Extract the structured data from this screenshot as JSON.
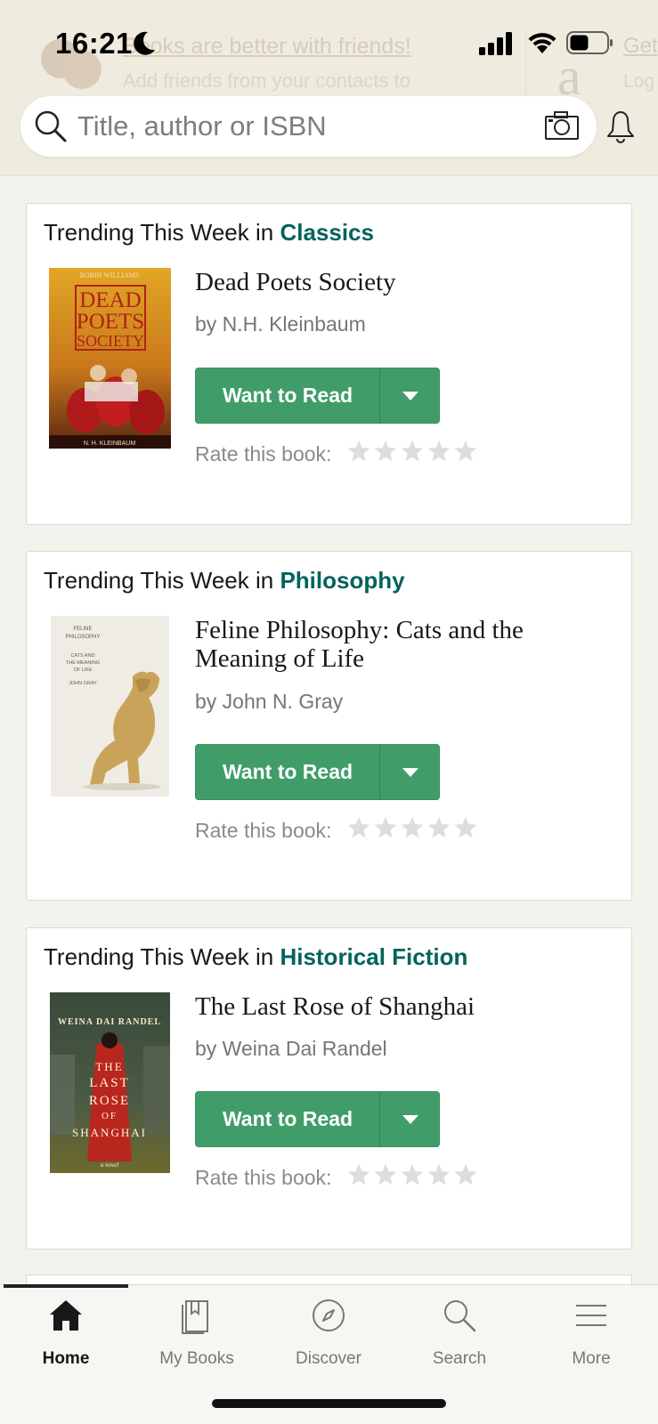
{
  "status_bar": {
    "time": "16:21"
  },
  "banner": {
    "title": "Books are better with friends!",
    "subtitle": "Add friends from your contacts to",
    "right_title": "Get",
    "right_sub": "Log"
  },
  "search": {
    "placeholder": "Title, author or ISBN"
  },
  "heading_prefix": "Trending This Week in",
  "want_to_read_label": "Want to Read",
  "rate_label": "Rate this book:",
  "cards": [
    {
      "genre": "Classics",
      "title": "Dead Poets Society",
      "author": "by N.H. Kleinbaum",
      "cover": {
        "top_text": "ROBIN WILLIAMS",
        "line1": "DEAD",
        "line2": "POETS",
        "line3": "SOCIETY",
        "bottom_text": "N. H. KLEINBAUM"
      },
      "rating": 0
    },
    {
      "genre": "Philosophy",
      "title": "Feline Philosophy: Cats and the Meaning of Life",
      "author": "by John N. Gray",
      "cover": {
        "line1": "FELINE",
        "line2": "PHILOSOPHY",
        "line3": "CATS AND",
        "line4": "THE MEANING",
        "line5": "OF LIFE",
        "line6": "JOHN GRAY"
      },
      "rating": 0
    },
    {
      "genre": "Historical Fiction",
      "title": "The Last Rose of Shanghai",
      "author": "by Weina Dai Randel",
      "cover": {
        "top_text": "WEINA DAI RANDEL",
        "line1": "THE",
        "line2": "LAST",
        "line3": "ROSE",
        "line4": "OF",
        "line5": "SHANGHAI",
        "bottom_text": "a novel"
      },
      "rating": 0
    }
  ],
  "nav": {
    "items": [
      {
        "label": "Home",
        "icon": "home-icon"
      },
      {
        "label": "My Books",
        "icon": "my-books-icon"
      },
      {
        "label": "Discover",
        "icon": "compass-icon"
      },
      {
        "label": "Search",
        "icon": "search-icon"
      },
      {
        "label": "More",
        "icon": "menu-icon"
      }
    ],
    "active": "Home"
  },
  "colors": {
    "accent_green": "#409d69",
    "genre_teal": "#00635d",
    "header_bg": "#efebdf",
    "page_bg": "#f4f2ec"
  }
}
